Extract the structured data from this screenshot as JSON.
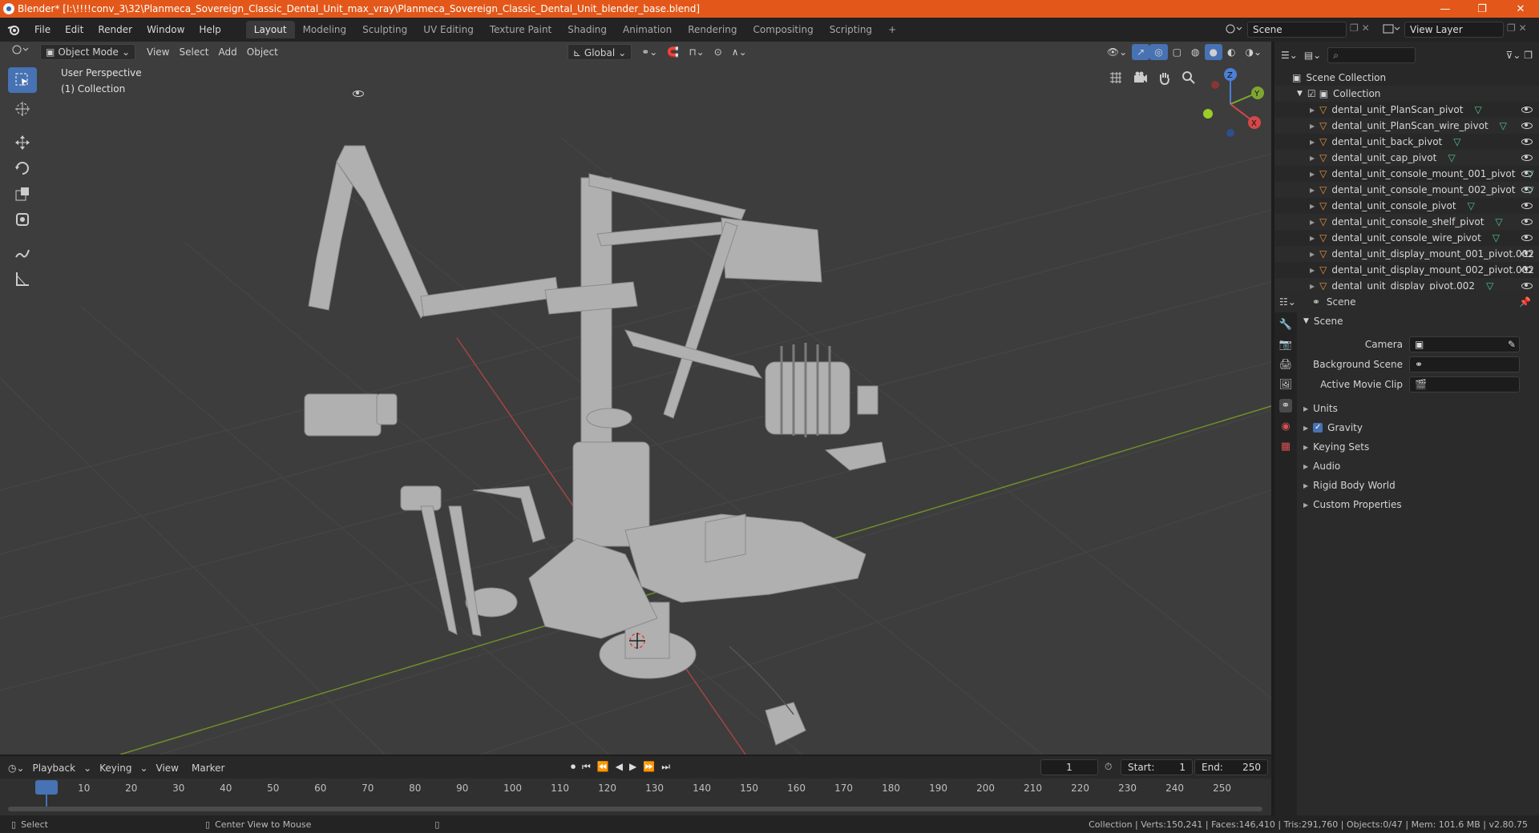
{
  "window": {
    "title": "Blender* [I:\\!!!!conv_3\\32\\Planmeca_Sovereign_Classic_Dental_Unit_max_vray\\Planmeca_Sovereign_Classic_Dental_Unit_blender_base.blend]",
    "controls": [
      "—",
      "❐",
      "✕"
    ]
  },
  "menu": {
    "items": [
      "File",
      "Edit",
      "Render",
      "Window",
      "Help"
    ],
    "workspaces": [
      "Layout",
      "Modeling",
      "Sculpting",
      "UV Editing",
      "Texture Paint",
      "Shading",
      "Animation",
      "Rendering",
      "Compositing",
      "Scripting"
    ],
    "active_workspace": "Layout",
    "add_tab": "+",
    "scene_name": "Scene",
    "view_layer": "View Layer"
  },
  "viewport_header": {
    "mode": "Object Mode",
    "menus": [
      "View",
      "Select",
      "Add",
      "Object"
    ],
    "orientation": "Global"
  },
  "viewport": {
    "info_line1": "User Perspective",
    "info_line2": "(1) Collection",
    "gizmo_axes": [
      "Z",
      "Y",
      "X"
    ],
    "colors": {
      "background": "#3d3d3d",
      "grid": "#4a4a4a",
      "x_axis": "#b34a4a",
      "y_axis": "#7a9a2e",
      "model": "#b3b3b3"
    }
  },
  "toolbar": {
    "tools": [
      "select-box-icon",
      "cursor-icon",
      "move-icon",
      "rotate-icon",
      "scale-icon",
      "transform-icon",
      "annotate-icon",
      "measure-icon"
    ]
  },
  "outliner": {
    "search_placeholder": "",
    "root": "Scene Collection",
    "collection": "Collection",
    "objects": [
      "dental_unit_PlanScan_pivot",
      "dental_unit_PlanScan_wire_pivot",
      "dental_unit_back_pivot",
      "dental_unit_cap_pivot",
      "dental_unit_console_mount_001_pivot",
      "dental_unit_console_mount_002_pivot",
      "dental_unit_console_pivot",
      "dental_unit_console_shelf_pivot",
      "dental_unit_console_wire_pivot",
      "dental_unit_display_mount_001_pivot.002",
      "dental_unit_display_mount_002_pivot.002",
      "dental_unit_display_pivot.002"
    ]
  },
  "properties": {
    "context": "Scene",
    "panel_title": "Scene",
    "camera_label": "Camera",
    "bg_scene_label": "Background Scene",
    "movie_clip_label": "Active Movie Clip",
    "sections": [
      "Units",
      "Gravity",
      "Keying Sets",
      "Audio",
      "Rigid Body World",
      "Custom Properties"
    ],
    "gravity_checked": true
  },
  "timeline": {
    "menus": [
      "Playback",
      "Keying",
      "View",
      "Marker"
    ],
    "current_frame": "1",
    "start_label": "Start:",
    "start": "1",
    "end_label": "End:",
    "end": "250",
    "ticks": [
      "1",
      "10",
      "20",
      "30",
      "40",
      "50",
      "60",
      "70",
      "80",
      "90",
      "100",
      "110",
      "120",
      "130",
      "140",
      "150",
      "160",
      "170",
      "180",
      "190",
      "200",
      "210",
      "220",
      "230",
      "240",
      "250"
    ]
  },
  "status": {
    "left_action": "Select",
    "middle_action": "Center View to Mouse",
    "stats": "Collection | Verts:150,241 | Faces:146,410 | Tris:291,760 | Objects:0/47 | Mem: 101.6 MB | v2.80.75"
  }
}
